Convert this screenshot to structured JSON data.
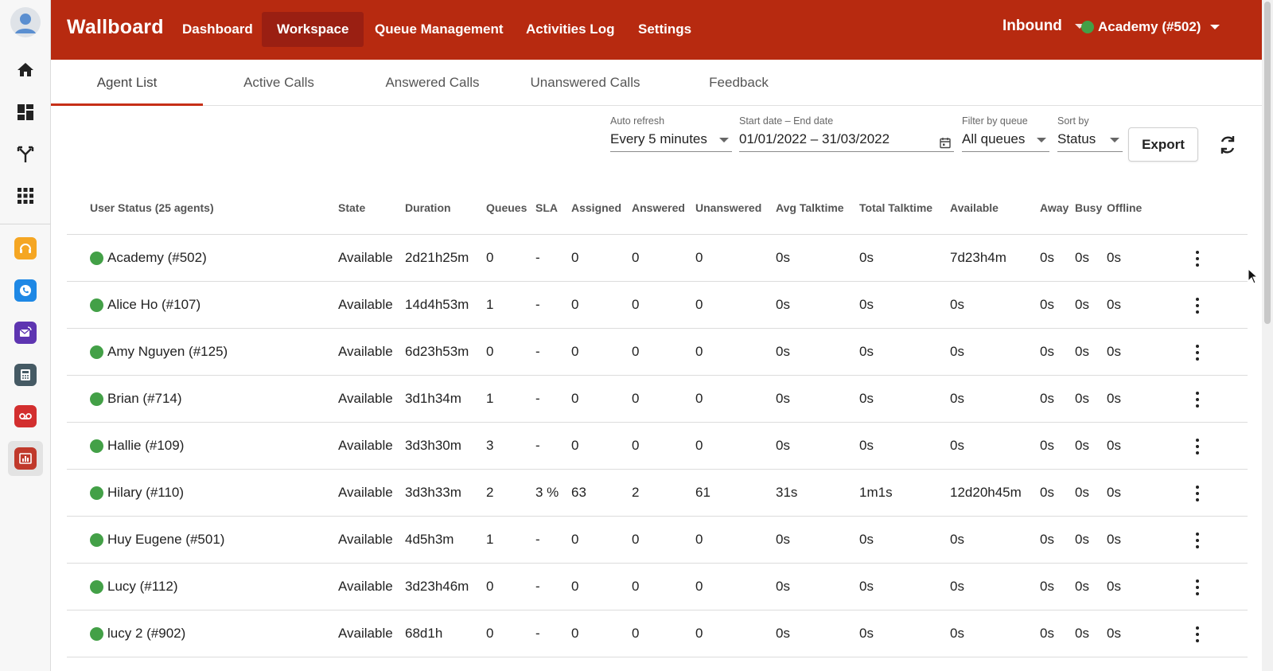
{
  "topbar": {
    "brand": "Wallboard",
    "nav": [
      "Dashboard",
      "Workspace",
      "Queue Management",
      "Activities Log",
      "Settings"
    ],
    "active_nav": "Workspace",
    "direction": "Inbound",
    "account": "Academy (#502)",
    "account_status_color": "#43a047"
  },
  "sidebar": {
    "icons": [
      "avatar-icon",
      "home-icon",
      "dashboard-icon",
      "merge-icon",
      "apps-grid-icon",
      "headset-app-icon",
      "phone-app-icon",
      "email-app-icon",
      "desk-phone-app-icon",
      "voicemail-app-icon",
      "wallboard-app-icon"
    ]
  },
  "tabs": [
    "Agent List",
    "Active Calls",
    "Answered Calls",
    "Unanswered Calls",
    "Feedback"
  ],
  "active_tab": "Agent List",
  "filters": {
    "auto_refresh": {
      "label": "Auto refresh",
      "value": "Every 5 minutes"
    },
    "date_range": {
      "label": "Start date – End date",
      "value": "01/01/2022 – 31/03/2022"
    },
    "queue": {
      "label": "Filter by queue",
      "value": "All queues"
    },
    "sort": {
      "label": "Sort by",
      "value": "Status"
    },
    "export_label": "Export"
  },
  "table": {
    "headers": [
      "User Status (25 agents)",
      "State",
      "Duration",
      "Queues",
      "SLA",
      "Assigned",
      "Answered",
      "Unanswered",
      "Avg Talktime",
      "Total Talktime",
      "Available",
      "Away",
      "Busy",
      "Offline"
    ],
    "rows": [
      [
        "Academy (#502)",
        "Available",
        "2d21h25m",
        "0",
        "-",
        "0",
        "0",
        "0",
        "0s",
        "0s",
        "7d23h4m",
        "0s",
        "0s",
        "0s"
      ],
      [
        "Alice Ho (#107)",
        "Available",
        "14d4h53m",
        "1",
        "-",
        "0",
        "0",
        "0",
        "0s",
        "0s",
        "0s",
        "0s",
        "0s",
        "0s"
      ],
      [
        "Amy Nguyen (#125)",
        "Available",
        "6d23h53m",
        "0",
        "-",
        "0",
        "0",
        "0",
        "0s",
        "0s",
        "0s",
        "0s",
        "0s",
        "0s"
      ],
      [
        "Brian (#714)",
        "Available",
        "3d1h34m",
        "1",
        "-",
        "0",
        "0",
        "0",
        "0s",
        "0s",
        "0s",
        "0s",
        "0s",
        "0s"
      ],
      [
        "Hallie (#109)",
        "Available",
        "3d3h30m",
        "3",
        "-",
        "0",
        "0",
        "0",
        "0s",
        "0s",
        "0s",
        "0s",
        "0s",
        "0s"
      ],
      [
        "Hilary (#110)",
        "Available",
        "3d3h33m",
        "2",
        "3 %",
        "63",
        "2",
        "61",
        "31s",
        "1m1s",
        "12d20h45m",
        "0s",
        "0s",
        "0s"
      ],
      [
        "Huy Eugene (#501)",
        "Available",
        "4d5h3m",
        "1",
        "-",
        "0",
        "0",
        "0",
        "0s",
        "0s",
        "0s",
        "0s",
        "0s",
        "0s"
      ],
      [
        "Lucy (#112)",
        "Available",
        "3d23h46m",
        "0",
        "-",
        "0",
        "0",
        "0",
        "0s",
        "0s",
        "0s",
        "0s",
        "0s",
        "0s"
      ],
      [
        "lucy 2 (#902)",
        "Available",
        "68d1h",
        "0",
        "-",
        "0",
        "0",
        "0",
        "0s",
        "0s",
        "0s",
        "0s",
        "0s",
        "0s"
      ]
    ]
  },
  "colors": {
    "brand_red": "#b72a10",
    "active_nav": "#9a1f12",
    "tab_ink": "#c62f17",
    "status_available": "#43a047"
  }
}
